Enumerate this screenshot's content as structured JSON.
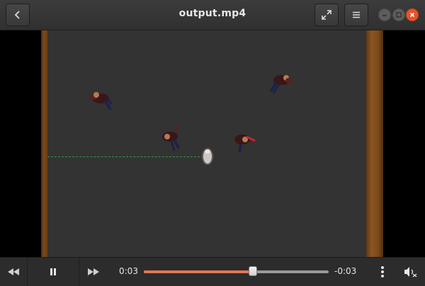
{
  "window": {
    "title": "output.mp4"
  },
  "header": {
    "icons": [
      "back-arrow-icon",
      "fullscreen-icon",
      "menu-icon"
    ],
    "window_controls": [
      "minimize",
      "maximize",
      "close"
    ]
  },
  "playback": {
    "elapsed": "0:03",
    "remaining": "-0:03",
    "progress": 0.59,
    "state": "playing"
  },
  "colors": {
    "accent": "#e0765a",
    "close_button": "#e5532d",
    "floor": "#333333",
    "trail": "#2f9c3c"
  }
}
